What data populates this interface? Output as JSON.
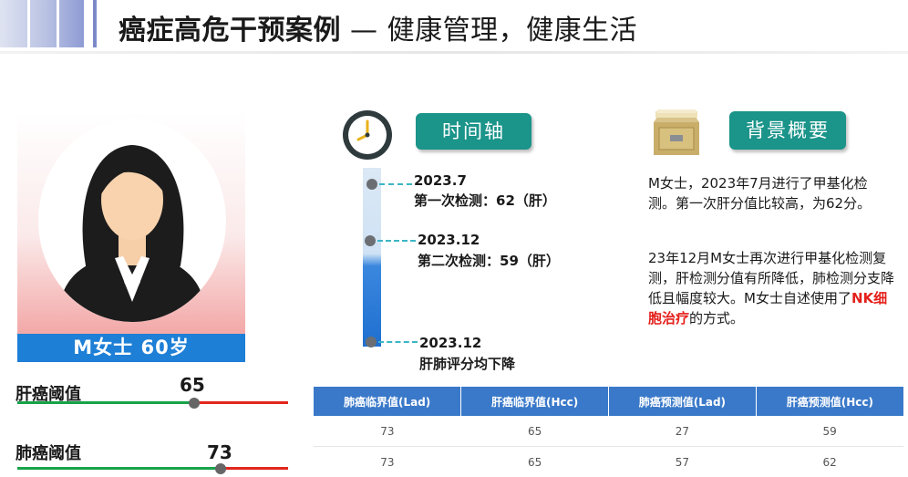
{
  "slide": {
    "title_bold": "癌症高危干预案例",
    "title_rest": " — 健康管理，健康生活"
  },
  "patient": {
    "name_label": "M女士  60岁"
  },
  "thresholds": [
    {
      "label": "肝癌阈值",
      "value": "65",
      "level_percent": 65
    },
    {
      "label": "肺癌阈值",
      "value": "73",
      "level_percent": 73
    }
  ],
  "timeline": {
    "header": "时间轴",
    "events": [
      {
        "date": "2023.7",
        "desc": "第一次检测：62（肝）"
      },
      {
        "date": "2023.12",
        "desc": "第二次检测：59（肝）"
      },
      {
        "date": "2023.12",
        "desc": "肝肺评分均下降"
      }
    ]
  },
  "background": {
    "header": "背景概要",
    "para1": "M女士，2023年7月进行了甲基化检测。第一次肝分值比较高，为62分。",
    "para2_a": "23年12月M女士再次进行甲基化检测复测，肝检测分值有所降低，肺检测分支降低且幅度较大。M女士自述使用了",
    "para2_highlight": "NK细胞治疗",
    "para2_b": "的方式。"
  },
  "table": {
    "headers": [
      "肺癌临界值(Lad)",
      "肝癌临界值(Hcc)",
      "肺癌预测值(Lad)",
      "肝癌预测值(Hcc)"
    ],
    "rows": [
      [
        "73",
        "65",
        "27",
        "59"
      ],
      [
        "73",
        "65",
        "57",
        "62"
      ]
    ]
  },
  "colors": {
    "accent_teal": "#1b948a",
    "name_bar_blue": "#1e7fd6",
    "table_header_blue": "#3a79c9",
    "slider_green": "#17a24a",
    "slider_red": "#e1261c",
    "highlight_red": "#e4201b"
  },
  "icons": {
    "clock": "clock-icon",
    "cabinet": "file-cabinet-icon",
    "avatar": "woman-avatar-icon"
  }
}
